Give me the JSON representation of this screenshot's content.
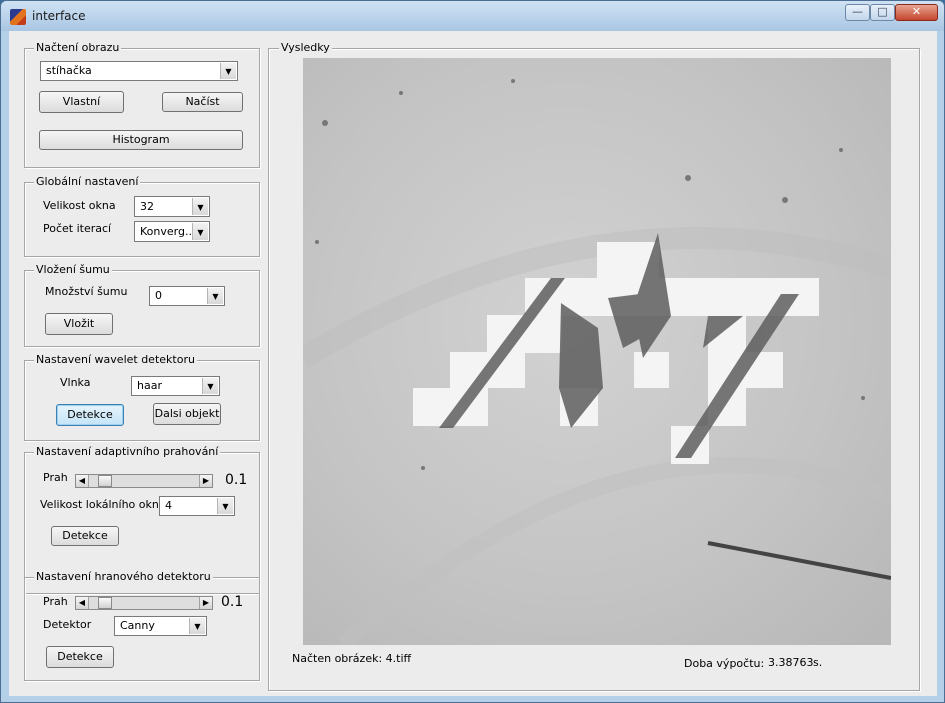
{
  "window": {
    "title": "interface",
    "min_glyph": "—",
    "max_glyph": "□",
    "close_glyph": "✕"
  },
  "load_panel": {
    "title": "Načtení obrazu",
    "image_select": "stíhačka",
    "custom_button": "Vlastní",
    "load_button": "Načíst",
    "histogram_button": "Histogram"
  },
  "global_panel": {
    "title": "Globální nastavení",
    "window_size_label": "Velikost okna",
    "window_size_value": "32",
    "iterations_label": "Počet iterací",
    "iterations_value": "Konverg..."
  },
  "noise_panel": {
    "title": "Vložení šumu",
    "amount_label": "Množství šumu",
    "amount_value": "0",
    "insert_button": "Vložit"
  },
  "wavelet_panel": {
    "title": "Nastavení wavelet detektoru",
    "wavelet_label": "Vlnka",
    "wavelet_value": "haar",
    "detect_button": "Detekce",
    "next_button": "Dalsi objekt"
  },
  "adaptive_panel": {
    "title": "Nastavení adaptivního prahování",
    "threshold_label": "Prah",
    "threshold_value": "0.1",
    "threshold_position": 0.1,
    "local_window_label": "Velikost lokálního okna",
    "local_window_value": "4",
    "detect_button": "Detekce"
  },
  "edge_panel": {
    "title": "Nastavení hranového detektoru",
    "threshold_label": "Prah",
    "threshold_value": "0.1",
    "threshold_position": 0.1,
    "detector_label": "Detektor",
    "detector_value": "Canny",
    "detect_button": "Detekce"
  },
  "results_panel": {
    "title": "Vysledky",
    "loaded_image_text": "Načten obrázek: 4.tiff",
    "time_label": "Doba výpočtu:",
    "time_value": "3.38763",
    "time_unit": "s."
  },
  "icons": {
    "dropdown": "▼",
    "left": "◀",
    "right": "▶"
  }
}
